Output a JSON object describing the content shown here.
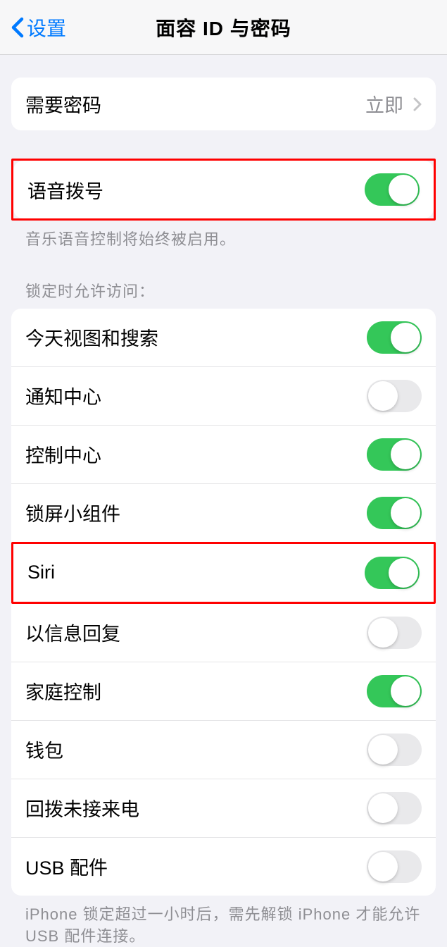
{
  "nav": {
    "back_label": "设置",
    "title": "面容 ID 与密码"
  },
  "require_passcode": {
    "label": "需要密码",
    "value": "立即"
  },
  "voice_dial": {
    "label": "语音拨号",
    "enabled": true,
    "footer": "音乐语音控制将始终被启用。"
  },
  "locked_access": {
    "header": "锁定时允许访问：",
    "items": [
      {
        "label": "今天视图和搜索",
        "enabled": true
      },
      {
        "label": "通知中心",
        "enabled": false
      },
      {
        "label": "控制中心",
        "enabled": true
      },
      {
        "label": "锁屏小组件",
        "enabled": true
      },
      {
        "label": "Siri",
        "enabled": true
      },
      {
        "label": "以信息回复",
        "enabled": false
      },
      {
        "label": "家庭控制",
        "enabled": true
      },
      {
        "label": "钱包",
        "enabled": false
      },
      {
        "label": "回拨未接来电",
        "enabled": false
      },
      {
        "label": "USB 配件",
        "enabled": false
      }
    ],
    "footer": "iPhone 锁定超过一小时后，需先解锁 iPhone 才能允许USB 配件连接。"
  }
}
